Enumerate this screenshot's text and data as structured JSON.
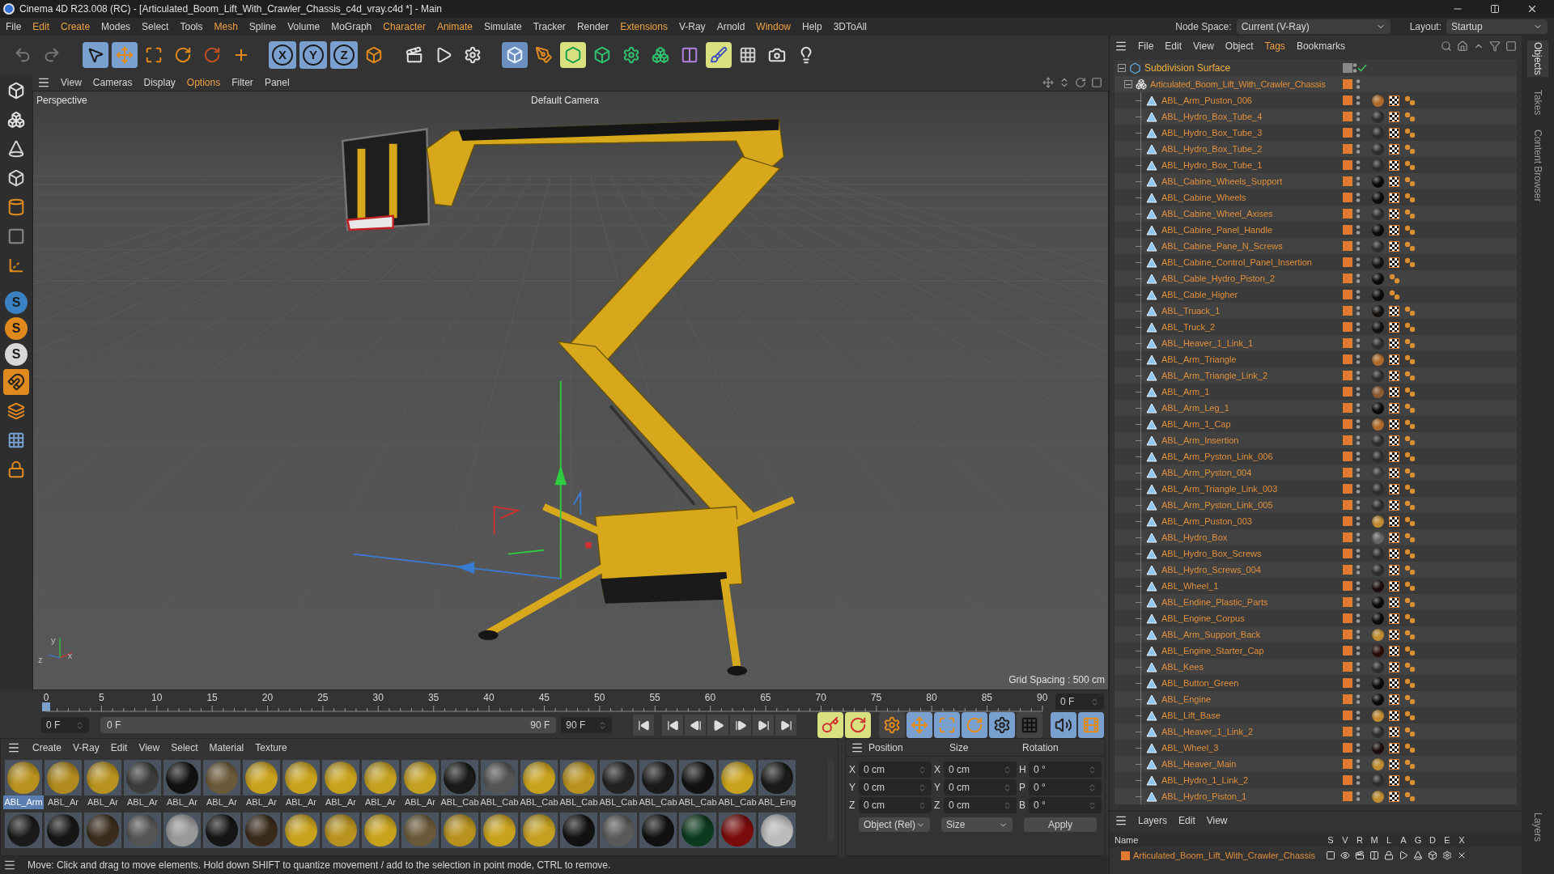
{
  "window": {
    "title": "Cinema 4D R23.008 (RC) - [Articulated_Boom_Lift_With_Crawler_Chassis_c4d_vray.c4d *] - Main"
  },
  "menu": [
    {
      "label": "File",
      "highlighted": false
    },
    {
      "label": "Edit",
      "highlighted": true
    },
    {
      "label": "Create",
      "highlighted": true
    },
    {
      "label": "Modes",
      "highlighted": false
    },
    {
      "label": "Select",
      "highlighted": false
    },
    {
      "label": "Tools",
      "highlighted": false
    },
    {
      "label": "Mesh",
      "highlighted": true
    },
    {
      "label": "Spline",
      "highlighted": false
    },
    {
      "label": "Volume",
      "highlighted": false
    },
    {
      "label": "MoGraph",
      "highlighted": false
    },
    {
      "label": "Character",
      "highlighted": true
    },
    {
      "label": "Animate",
      "highlighted": true
    },
    {
      "label": "Simulate",
      "highlighted": false
    },
    {
      "label": "Tracker",
      "highlighted": false
    },
    {
      "label": "Render",
      "highlighted": false
    },
    {
      "label": "Extensions",
      "highlighted": true
    },
    {
      "label": "V-Ray",
      "highlighted": false
    },
    {
      "label": "Arnold",
      "highlighted": false
    },
    {
      "label": "Window",
      "highlighted": true
    },
    {
      "label": "Help",
      "highlighted": false
    },
    {
      "label": "3DToAll",
      "highlighted": false
    }
  ],
  "node_space": {
    "label": "Node Space:",
    "value": "Current (V-Ray)"
  },
  "layout": {
    "label": "Layout:",
    "value": "Startup"
  },
  "axis_locks": [
    {
      "label": "X",
      "on": true
    },
    {
      "label": "Y",
      "on": true
    },
    {
      "label": "Z",
      "on": true
    }
  ],
  "snap_buttons": [
    {
      "label": "S",
      "color": "#3b82c4"
    },
    {
      "label": "S",
      "color": "#e08a1e"
    },
    {
      "label": "S",
      "color": "#d8d8d8"
    }
  ],
  "viewport": {
    "menu": [
      {
        "label": "View",
        "highlighted": false
      },
      {
        "label": "Cameras",
        "highlighted": false
      },
      {
        "label": "Display",
        "highlighted": false
      },
      {
        "label": "Options",
        "highlighted": true
      },
      {
        "label": "Filter",
        "highlighted": false
      },
      {
        "label": "Panel",
        "highlighted": false
      }
    ],
    "name": "Perspective",
    "camera": "Default Camera",
    "grid_spacing": "Grid Spacing : 500 cm",
    "axis_labels": [
      "y",
      "z",
      "x"
    ]
  },
  "timeline": {
    "ticks": [
      "0",
      "5",
      "10",
      "15",
      "20",
      "25",
      "30",
      "35",
      "40",
      "45",
      "50",
      "55",
      "60",
      "65",
      "70",
      "75",
      "80",
      "85",
      "90"
    ],
    "current": "0 F",
    "start": "0 F",
    "range_start": "0 F",
    "range_end": "90 F",
    "end": "90 F"
  },
  "materials": {
    "menu": [
      {
        "label": "Create",
        "highlighted": false
      },
      {
        "label": "V-Ray",
        "highlighted": false
      },
      {
        "label": "Edit",
        "highlighted": false
      },
      {
        "label": "View",
        "highlighted": false
      },
      {
        "label": "Select",
        "highlighted": false
      },
      {
        "label": "Material",
        "highlighted": false
      },
      {
        "label": "Texture",
        "highlighted": false
      }
    ],
    "rows": [
      [
        {
          "label": "ABL_Arm",
          "color": "#b8921e",
          "selected": true
        },
        {
          "label": "ABL_Ar",
          "color": "#b08a1e",
          "selected": false
        },
        {
          "label": "ABL_Ar",
          "color": "#b8921e",
          "selected": false
        },
        {
          "label": "ABL_Ar",
          "color": "#3c3c3c",
          "selected": false
        },
        {
          "label": "ABL_Ar",
          "color": "#111111",
          "selected": false
        },
        {
          "label": "ABL_Ar",
          "color": "#6b5a3a",
          "selected": false
        },
        {
          "label": "ABL_Ar",
          "color": "#c9a21c",
          "selected": false
        },
        {
          "label": "ABL_Ar",
          "color": "#c9a21c",
          "selected": false
        },
        {
          "label": "ABL_Ar",
          "color": "#c9a21c",
          "selected": false
        },
        {
          "label": "ABL_Ar",
          "color": "#c4a020",
          "selected": false
        },
        {
          "label": "ABL_Ar",
          "color": "#c4a020",
          "selected": false
        },
        {
          "label": "ABL_Cab",
          "color": "#1a1a1a",
          "selected": false
        },
        {
          "label": "ABL_Cab",
          "color": "#555555",
          "selected": false
        },
        {
          "label": "ABL_Cab",
          "color": "#c9a21c",
          "selected": false
        },
        {
          "label": "ABL_Cab",
          "color": "#b8921e",
          "selected": false
        },
        {
          "label": "ABL_Cab",
          "color": "#222222",
          "selected": false
        },
        {
          "label": "ABL_Cab",
          "color": "#1a1a1a",
          "selected": false
        },
        {
          "label": "ABL_Cab",
          "color": "#111111",
          "selected": false
        },
        {
          "label": "ABL_Cab",
          "color": "#c9a21c",
          "selected": false
        },
        {
          "label": "ABL_Eng",
          "color": "#1a1a1a",
          "selected": false
        }
      ],
      [
        {
          "color": "#1a1a1a"
        },
        {
          "color": "#161616"
        },
        {
          "color": "#3a2c1c"
        },
        {
          "color": "#555555"
        },
        {
          "color": "#999999"
        },
        {
          "color": "#151515"
        },
        {
          "color": "#3a2a1a"
        },
        {
          "color": "#c9a21c"
        },
        {
          "color": "#b8921e"
        },
        {
          "color": "#c9a21c"
        },
        {
          "color": "#6b5a3a"
        },
        {
          "color": "#b8921e"
        },
        {
          "color": "#c9a21c"
        },
        {
          "color": "#c4a020"
        },
        {
          "color": "#111111"
        },
        {
          "color": "#5a5a5a"
        },
        {
          "color": "#111111"
        },
        {
          "color": "#0b3a1e"
        },
        {
          "color": "#7a0b0b"
        },
        {
          "color": "#bbbbbb"
        }
      ]
    ]
  },
  "coordinates": {
    "headers": [
      "Position",
      "Size",
      "Rotation"
    ],
    "rows": [
      {
        "axis": "X",
        "position": "0 cm",
        "size_axis": "X",
        "size": "0 cm",
        "rotation_axis": "H",
        "rotation": "0 °"
      },
      {
        "axis": "Y",
        "position": "0 cm",
        "size_axis": "Y",
        "size": "0 cm",
        "rotation_axis": "P",
        "rotation": "0 °"
      },
      {
        "axis": "Z",
        "position": "0 cm",
        "size_axis": "Z",
        "size": "0 cm",
        "rotation_axis": "B",
        "rotation": "0 °"
      }
    ],
    "mode": "Object (Rel)",
    "size_mode": "Size",
    "apply": "Apply"
  },
  "status_bar": "Move: Click and drag to move elements. Hold down SHIFT to quantize movement / add to the selection in point mode, CTRL to remove.",
  "object_manager": {
    "menu": [
      {
        "label": "File",
        "highlighted": false
      },
      {
        "label": "Edit",
        "highlighted": false
      },
      {
        "label": "View",
        "highlighted": false
      },
      {
        "label": "Object",
        "highlighted": false
      },
      {
        "label": "Tags",
        "highlighted": true
      },
      {
        "label": "Bookmarks",
        "highlighted": false
      }
    ],
    "objects": [
      {
        "name": "Subdivision Surface",
        "expanded": true,
        "children": [
          {
            "name": "Articulated_Boom_Lift_With_Crawler_Chassis",
            "expanded": true,
            "children": [
              {
                "name": "ABL_Arm_Puston_006",
                "color": "#b06a2a",
                "uvw": true
              },
              {
                "name": "ABL_Hydro_Box_Tube_4",
                "color": "#2e2e2e",
                "uvw": true
              },
              {
                "name": "ABL_Hydro_Box_Tube_3",
                "color": "#2e2e2e",
                "uvw": true
              },
              {
                "name": "ABL_Hydro_Box_Tube_2",
                "color": "#2e2e2e",
                "uvw": true
              },
              {
                "name": "ABL_Hydro_Box_Tube_1",
                "color": "#2e2e2e",
                "uvw": true
              },
              {
                "name": "ABL_Cabine_Wheels_Support",
                "color": "#0a0a0a",
                "uvw": true
              },
              {
                "name": "ABL_Cabine_Wheels",
                "color": "#0a0a0a",
                "uvw": true
              },
              {
                "name": "ABL_Cabine_Wheel_Axises",
                "color": "#2e2e2e",
                "uvw": true
              },
              {
                "name": "ABL_Cabine_Panel_Handle",
                "color": "#0a0a0a",
                "uvw": true
              },
              {
                "name": "ABL_Cabine_Pane_N_Screws",
                "color": "#2e2e2e",
                "uvw": true
              },
              {
                "name": "ABL_Cabine_Control_Panel_Insertion",
                "color": "#141414",
                "uvw": true
              },
              {
                "name": "ABL_Cable_Hydro_Piston_2",
                "color": "#0a0a0a",
                "uvw": false
              },
              {
                "name": "ABL_Cable_Higher",
                "color": "#0a0a0a",
                "uvw": false
              },
              {
                "name": "ABL_Truack_1",
                "color": "#161210",
                "uvw": true
              },
              {
                "name": "ABL_Truck_2",
                "color": "#121212",
                "uvw": true
              },
              {
                "name": "ABL_Heaver_1_Link_1",
                "color": "#2e2e2e",
                "uvw": true
              },
              {
                "name": "ABL_Arm_Triangle",
                "color": "#b06a2a",
                "uvw": true
              },
              {
                "name": "ABL_Arm_Triangle_Link_2",
                "color": "#2e2e2e",
                "uvw": true
              },
              {
                "name": "ABL_Arm_1",
                "color": "#8a5a30",
                "uvw": true
              },
              {
                "name": "ABL_Arm_Leg_1",
                "color": "#0a0a0a",
                "uvw": true
              },
              {
                "name": "ABL_Arm_1_Cap",
                "color": "#b06a2a",
                "uvw": true
              },
              {
                "name": "ABL_Arm_Insertion",
                "color": "#2e2e2e",
                "uvw": true
              },
              {
                "name": "ABL_Arm_Pyston_Link_006",
                "color": "#2e2e2e",
                "uvw": true
              },
              {
                "name": "ABL_Arm_Pyston_004",
                "color": "#3a3a3a",
                "uvw": true
              },
              {
                "name": "ABL_Arm_Triangle_Link_003",
                "color": "#2e2e2e",
                "uvw": true
              },
              {
                "name": "ABL_Arm_Pyston_Link_005",
                "color": "#2e2e2e",
                "uvw": true
              },
              {
                "name": "ABL_Arm_Puston_003",
                "color": "#c08a30",
                "uvw": true
              },
              {
                "name": "ABL_Hydro_Box",
                "color": "#666666",
                "uvw": true
              },
              {
                "name": "ABL_Hydro_Box_Screws",
                "color": "#2e2e2e",
                "uvw": true
              },
              {
                "name": "ABL_Hydro_Screws_004",
                "color": "#2e2e2e",
                "uvw": true
              },
              {
                "name": "ABL_Wheel_1",
                "color": "#1c0c0c",
                "uvw": true
              },
              {
                "name": "ABL_Endine_Plastic_Parts",
                "color": "#0a0a0a",
                "uvw": true
              },
              {
                "name": "ABL_Engine_Corpus",
                "color": "#0a0a0a",
                "uvw": true
              },
              {
                "name": "ABL_Arm_Support_Back",
                "color": "#c08a30",
                "uvw": true
              },
              {
                "name": "ABL_Engine_Starter_Cap",
                "color": "#2a0e08",
                "uvw": true
              },
              {
                "name": "ABL_Kees",
                "color": "#2e2e2e",
                "uvw": true
              },
              {
                "name": "ABL_Button_Green",
                "color": "#0a0a0a",
                "uvw": true
              },
              {
                "name": "ABL_Engine",
                "color": "#0a0a0a",
                "uvw": true
              },
              {
                "name": "ABL_Lift_Base",
                "color": "#c08a30",
                "uvw": true
              },
              {
                "name": "ABL_Heaver_1_Link_2",
                "color": "#2e2e2e",
                "uvw": true
              },
              {
                "name": "ABL_Wheel_3",
                "color": "#1c0c0c",
                "uvw": true
              },
              {
                "name": "ABL_Heaver_Main",
                "color": "#c08a30",
                "uvw": true
              },
              {
                "name": "ABL_Hydro_1_Link_2",
                "color": "#2e2e2e",
                "uvw": true
              },
              {
                "name": "ABL_Hydro_Piston_1",
                "color": "#c08a30",
                "uvw": true
              }
            ]
          }
        ]
      }
    ]
  },
  "layers": {
    "menu": [
      {
        "label": "Layers",
        "highlighted": false
      },
      {
        "label": "Edit",
        "highlighted": false
      },
      {
        "label": "View",
        "highlighted": false
      }
    ],
    "columns": [
      "Name",
      "S",
      "V",
      "R",
      "M",
      "L",
      "A",
      "G",
      "D",
      "E",
      "X"
    ],
    "rows": [
      {
        "name": "Articulated_Boom_Lift_With_Crawler_Chassis",
        "color": "#e07a30"
      }
    ]
  },
  "side_tabs": [
    {
      "label": "Objects",
      "selected": true
    },
    {
      "label": "Takes",
      "selected": false
    },
    {
      "label": "Content Browser",
      "selected": false
    }
  ],
  "layers_tab": {
    "label": "Layers"
  }
}
